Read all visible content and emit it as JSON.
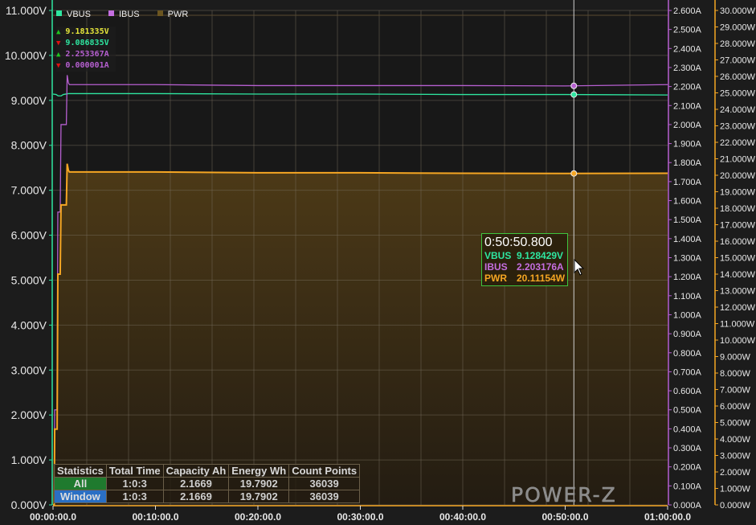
{
  "chart_data": {
    "type": "line",
    "title": "",
    "x_unit": "time",
    "x_ticks": [
      "00:00:00.0",
      "00:10:00.0",
      "00:20:00.0",
      "00:30:00.0",
      "00:40:00.0",
      "00:50:00.0",
      "01:00:00.0"
    ],
    "xlim_minutes": [
      0,
      60
    ],
    "axes": {
      "voltage": {
        "ylim": [
          0,
          11
        ],
        "ticks": [
          "0.000V",
          "1.000V",
          "2.000V",
          "3.000V",
          "4.000V",
          "5.000V",
          "6.000V",
          "7.000V",
          "8.000V",
          "9.000V",
          "10.000V",
          "11.000V"
        ],
        "position": "left"
      },
      "current": {
        "ylim": [
          0,
          2.6
        ],
        "ticks": [
          "0.000A",
          "0.100A",
          "0.200A",
          "0.300A",
          "0.400A",
          "0.500A",
          "0.600A",
          "0.700A",
          "0.800A",
          "0.900A",
          "1.000A",
          "1.100A",
          "1.200A",
          "1.300A",
          "1.400A",
          "1.500A",
          "1.600A",
          "1.700A",
          "1.800A",
          "1.900A",
          "2.000A",
          "2.100A",
          "2.200A",
          "2.300A",
          "2.400A",
          "2.500A",
          "2.600A"
        ],
        "position": "right",
        "color": "#b65fd0"
      },
      "power": {
        "ylim": [
          0,
          30
        ],
        "ticks": [
          "0.000W",
          "1.000W",
          "2.000W",
          "3.000W",
          "4.000W",
          "5.000W",
          "6.000W",
          "7.000W",
          "8.000W",
          "9.000W",
          "10.000W",
          "11.000W",
          "12.000W",
          "13.000W",
          "14.000W",
          "15.000W",
          "16.000W",
          "17.000W",
          "18.000W",
          "19.000W",
          "20.000W",
          "21.000W",
          "22.000W",
          "23.000W",
          "24.000W",
          "25.000W",
          "26.000W",
          "27.000W",
          "28.000W",
          "29.000W",
          "30.000W"
        ],
        "position": "far-right",
        "color": "#f5a623"
      }
    },
    "grid": true,
    "legend_position": "top-left",
    "series": [
      {
        "name": "VBUS",
        "axis": "voltage",
        "color": "#2ee6a0",
        "x": [
          0,
          0.3,
          0.5,
          0.8,
          1.0,
          1.5,
          10,
          20,
          30,
          40,
          50,
          60
        ],
        "y": [
          9.14,
          9.13,
          9.1,
          9.1,
          9.13,
          9.15,
          9.15,
          9.14,
          9.14,
          9.13,
          9.13,
          9.12
        ]
      },
      {
        "name": "IBUS",
        "axis": "current",
        "color": "#b65fd0",
        "x": [
          0,
          0.12,
          0.16,
          0.4,
          0.47,
          0.7,
          0.78,
          1.3,
          1.38,
          1.5,
          1.6,
          10,
          20,
          30,
          40,
          50,
          60
        ],
        "y": [
          0,
          0,
          0.5,
          0.5,
          1.54,
          1.54,
          2.0,
          2.0,
          2.26,
          2.22,
          2.21,
          2.21,
          2.205,
          2.205,
          2.205,
          2.203,
          2.21
        ]
      },
      {
        "name": "PWR",
        "axis": "power",
        "color": "#f5a623",
        "fill": "#4a3916",
        "x": [
          0,
          0.12,
          0.16,
          0.4,
          0.47,
          0.7,
          0.78,
          1.3,
          1.38,
          1.5,
          1.6,
          10,
          20,
          30,
          40,
          50,
          60
        ],
        "y": [
          0,
          0,
          4.6,
          4.6,
          14.0,
          14.0,
          18.2,
          18.2,
          20.7,
          20.3,
          20.2,
          20.2,
          20.15,
          20.15,
          20.12,
          20.11,
          20.12
        ]
      }
    ],
    "cursor_minutes": 50.8467
  },
  "legend": [
    {
      "name": "VBUS",
      "color": "#2ee6a0"
    },
    {
      "name": "IBUS",
      "color": "#c56ee0"
    },
    {
      "name": "PWR",
      "color": "#6b5520"
    }
  ],
  "minmax": [
    {
      "dir": "up",
      "value": "9.181335V",
      "color": "#e6e63a"
    },
    {
      "dir": "down",
      "value": "9.086835V",
      "color": "#2ee6a0"
    },
    {
      "dir": "up",
      "value": "2.253367A",
      "color": "#b65fd0"
    },
    {
      "dir": "down",
      "value": "0.000001A",
      "color": "#b65fd0"
    }
  ],
  "tooltip": {
    "time": "0:50:50.800",
    "rows": [
      {
        "label": "VBUS",
        "value": "9.128429V",
        "color": "#2ee6a0"
      },
      {
        "label": "IBUS",
        "value": "2.203176A",
        "color": "#c56ee0"
      },
      {
        "label": "PWR",
        "value": "20.11154W",
        "color": "#f5a623"
      }
    ]
  },
  "stats": {
    "headers": [
      "Statistics",
      "Total Time",
      "Capacity Ah",
      "Energy Wh",
      "Count Points"
    ],
    "rows": [
      [
        "All",
        "1:0:3",
        "2.1669",
        "19.7902",
        "36039"
      ],
      [
        "Window",
        "1:0:3",
        "2.1669",
        "19.7902",
        "36039"
      ]
    ]
  },
  "logo": "POWER-Z"
}
